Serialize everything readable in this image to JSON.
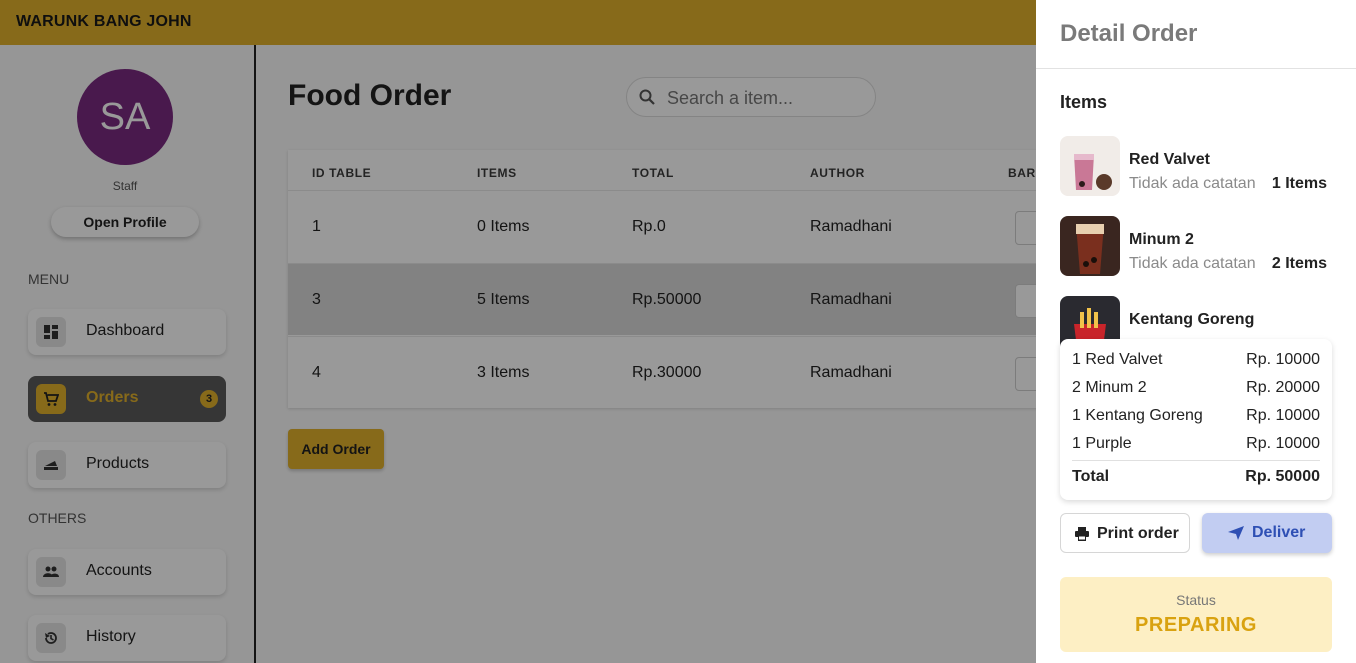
{
  "app": {
    "brand": "WARUNK BANG JOHN"
  },
  "profile": {
    "initials": "SA",
    "role": "Staff",
    "open_profile_label": "Open Profile"
  },
  "sidebar": {
    "menu_label": "MENU",
    "others_label": "OTHERS",
    "items": [
      {
        "label": "Dashboard",
        "icon": "dashboard-icon"
      },
      {
        "label": "Orders",
        "icon": "cart-icon",
        "badge": "3",
        "active": true
      },
      {
        "label": "Products",
        "icon": "food-icon"
      },
      {
        "label": "Accounts",
        "icon": "people-icon"
      },
      {
        "label": "History",
        "icon": "history-icon"
      }
    ]
  },
  "main": {
    "title": "Food Order",
    "search": {
      "placeholder": "Search a item..."
    },
    "table": {
      "headers": [
        "ID TABLE",
        "ITEMS",
        "TOTAL",
        "AUTHOR",
        "BARCODE"
      ],
      "rows": [
        {
          "id": "1",
          "items": "0 Items",
          "total": "Rp.0",
          "author": "Ramadhani"
        },
        {
          "id": "3",
          "items": "5 Items",
          "total": "Rp.50000",
          "author": "Ramadhani",
          "highlighted": true
        },
        {
          "id": "4",
          "items": "3 Items",
          "total": "Rp.30000",
          "author": "Ramadhani"
        }
      ]
    },
    "add_order_label": "Add Order"
  },
  "drawer": {
    "title": "Detail Order",
    "items_heading": "Items",
    "items": [
      {
        "name": "Red Valvet",
        "note": "Tidak ada catatan",
        "qty": "1 Items"
      },
      {
        "name": "Minum 2",
        "note": "Tidak ada catatan",
        "qty": "2 Items"
      },
      {
        "name": "Kentang Goreng",
        "note": "",
        "qty": ""
      }
    ],
    "summary": {
      "lines": [
        {
          "label": "1 Red Valvet",
          "price": "Rp. 10000"
        },
        {
          "label": "2 Minum 2",
          "price": "Rp. 20000"
        },
        {
          "label": "1 Kentang Goreng",
          "price": "Rp. 10000"
        },
        {
          "label": "1 Purple",
          "price": "Rp. 10000"
        }
      ],
      "total_label": "Total",
      "total_value": "Rp. 50000"
    },
    "print_label": "Print order",
    "deliver_label": "Deliver",
    "status_label": "Status",
    "status_value": "PREPARING"
  },
  "colors": {
    "accent": "#e1b12c",
    "avatar": "#7b2b80",
    "deliver_bg": "#c2cdf2",
    "deliver_text": "#2e4fb4",
    "status_bg": "#fdefc4",
    "status_text": "#d9a210"
  }
}
